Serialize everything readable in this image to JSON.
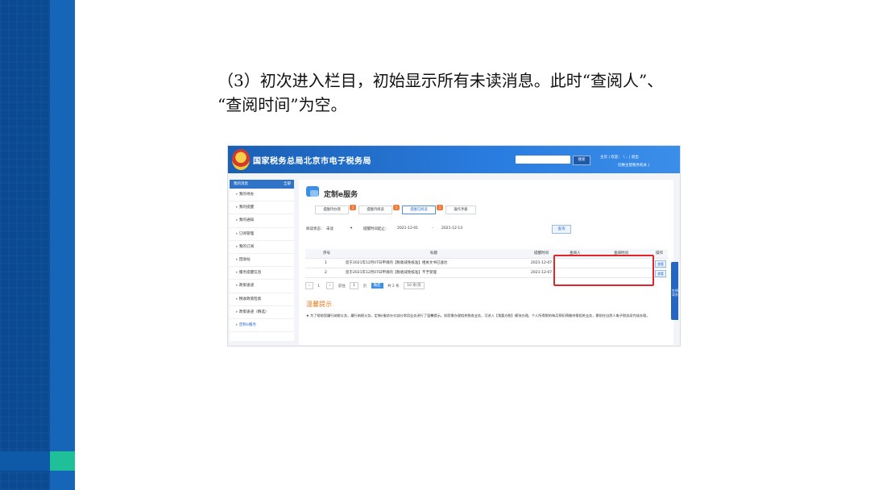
{
  "slide": {
    "headline_line1": "（3）初次进入栏目，初始显示所有未读消息。此时“查阅人”、",
    "headline_line2": "“查阅时间”为空。"
  },
  "app": {
    "site_title": "国家税务总局北京市电子税务局",
    "search_button": "搜索",
    "top_links_line1": "主页 | 欢迎：            !... | 退出",
    "top_links_line2": "切换主管税务机关    |",
    "sidebar": {
      "header": "我的消息",
      "header_action": "全部",
      "items": [
        "我的待办",
        "我的提醒",
        "我的通知",
        "订阅管理",
        "我的订阅",
        "回收站",
        "服务提醒信息",
        "政策速递",
        "税收政策检索",
        "政策速递（精选）",
        "定制e服务"
      ]
    },
    "service": {
      "title": "定制e服务",
      "tabs": [
        {
          "label": "提醒待办理",
          "badge": "1"
        },
        {
          "label": "提醒待阅读",
          "badge": "1"
        },
        {
          "label": "提醒已阅读",
          "badge": "1"
        },
        {
          "label": "操作手册",
          "badge": ""
        }
      ]
    },
    "filter": {
      "read_status_label": "阅读状态：",
      "read_status_value": "未读",
      "date_label": "提醒时间起止：",
      "date_from": "2021-12-01",
      "date_sep": "-",
      "date_to": "2021-12-13",
      "query_button": "查询"
    },
    "table": {
      "headers": [
        "序号",
        "标题",
        "提醒时间",
        "查阅人",
        "查阅时间",
        "操作"
      ],
      "rows": [
        {
          "no": "1",
          "title": "您于2021年12月07日申请的【税收减免核准】相关文书已送达",
          "time": "2021-12-07",
          "reader": "",
          "read_time": "",
          "action": "查看"
        },
        {
          "no": "2",
          "title": "您于2021年12月07日申请的【税收减免核准】不予受理",
          "time": "2021-12-07",
          "reader": "",
          "read_time": "",
          "action": "查看"
        }
      ]
    },
    "pager": {
      "prev": "‹",
      "page": "1",
      "next": "›",
      "goto_label": "前往",
      "goto_value": "1",
      "page_unit": "页",
      "confirm": "确定",
      "total": "共 2 条",
      "page_size": "10 条/页"
    },
    "tips": {
      "title": "温馨提示",
      "text": "★ 为了帮助您履行纳税义务，履行纳税义务，定制e服务针对部分常用业务进行了温馨提示。如您需办理相关税收业务，可进入【我要办税】模块办理。个人所得税的每月预扣预缴申报相关业务，需前往自然人电子税务局完成办理。"
    },
    "float_tab_text": "在线导办"
  }
}
